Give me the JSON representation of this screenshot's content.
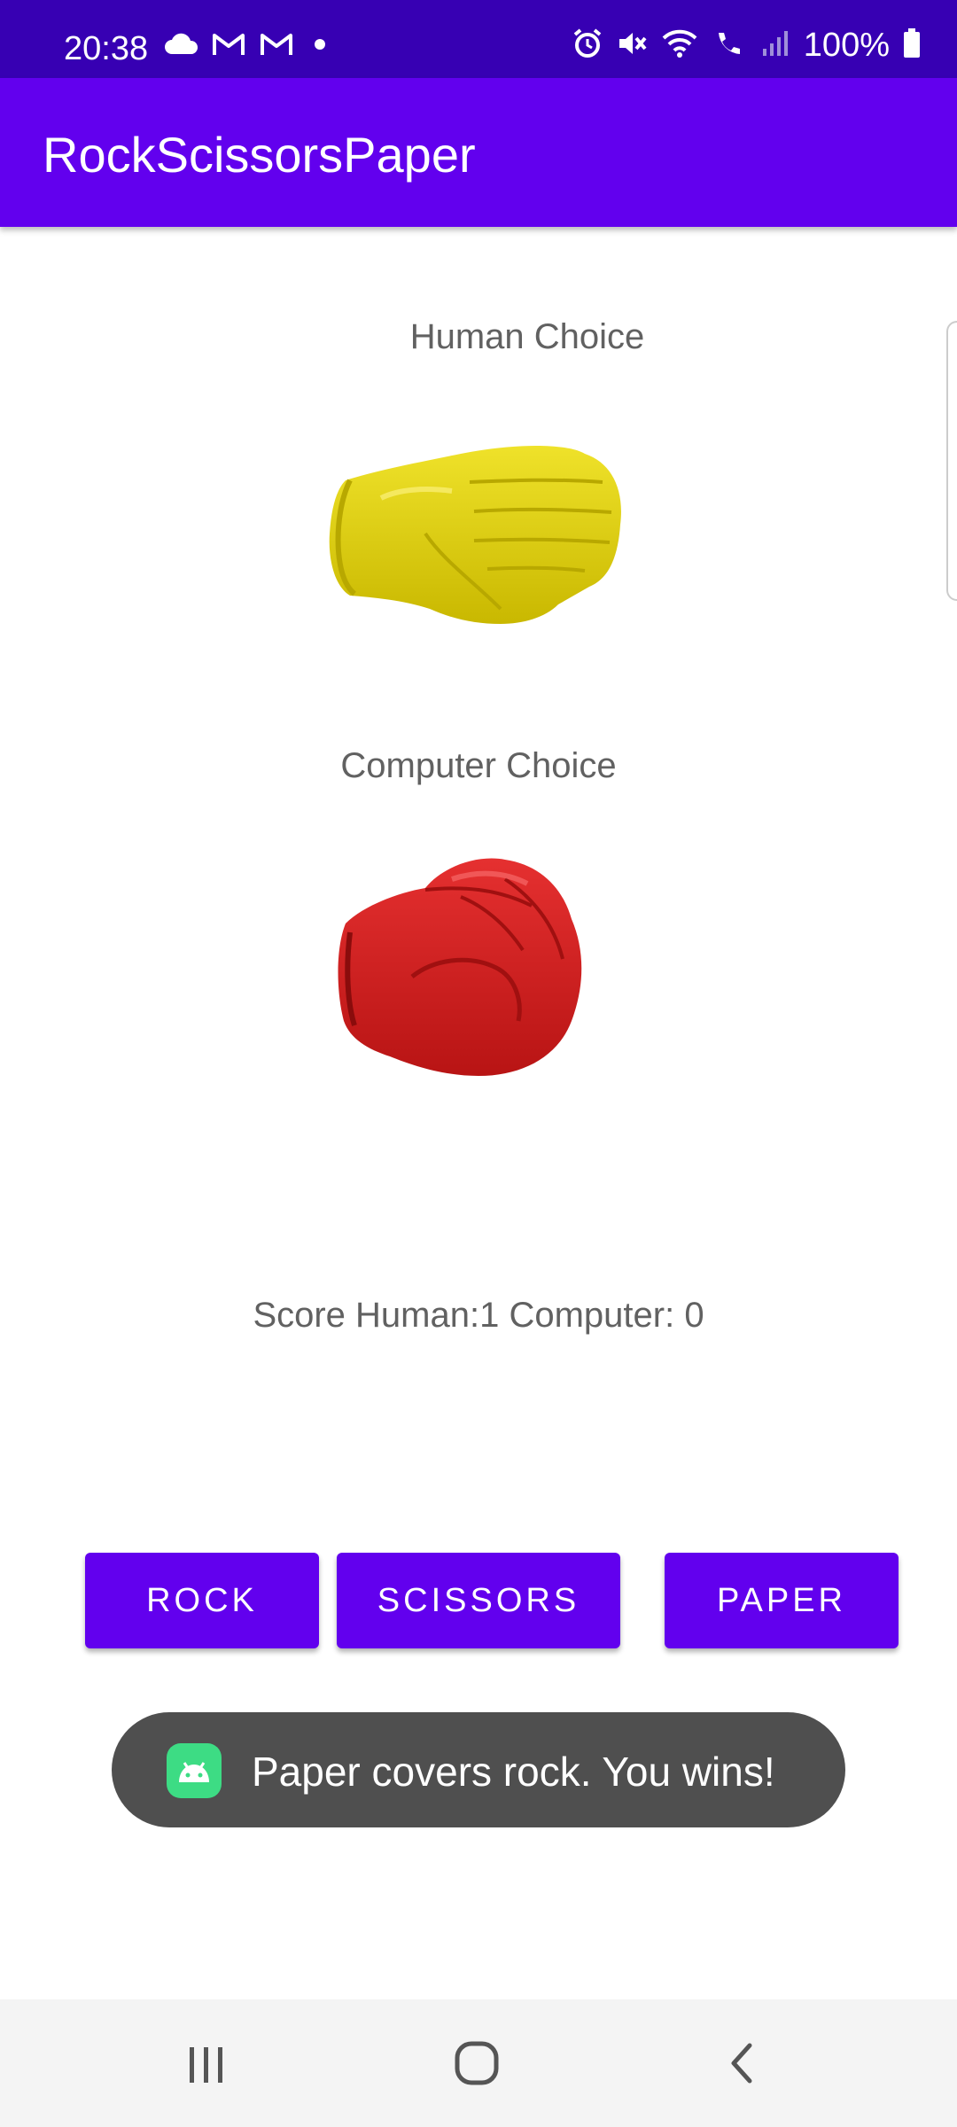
{
  "status_bar": {
    "time": "20:38",
    "battery": "100%",
    "left_icons": [
      "cloud-icon",
      "gmail-icon",
      "gmail-icon",
      "dot-icon"
    ],
    "right_icons": [
      "alarm-icon",
      "mute-icon",
      "wifi-icon",
      "wifi-calling-icon",
      "signal-icon",
      "battery-icon"
    ]
  },
  "app_bar": {
    "title": "RockScissorsPaper"
  },
  "main": {
    "human_label": "Human Choice",
    "human_choice_icon": "paper-hand-icon",
    "computer_label": "Computer Choice",
    "computer_choice_icon": "rock-fist-icon",
    "score": "Score Human:1 Computer: 0"
  },
  "buttons": {
    "rock": "ROCK",
    "scissors": "SCISSORS",
    "paper": "PAPER"
  },
  "toast": {
    "message": "Paper covers rock. You wins!"
  },
  "nav_bar": {
    "icons": [
      "recents-icon",
      "home-icon",
      "back-icon"
    ]
  },
  "colors": {
    "status_bar": "#3700B3",
    "app_bar": "#6200EE",
    "button": "#6200EE",
    "toast": "#4f4f4f",
    "paper_hand": "#e0d20c",
    "rock_fist": "#d42222"
  }
}
